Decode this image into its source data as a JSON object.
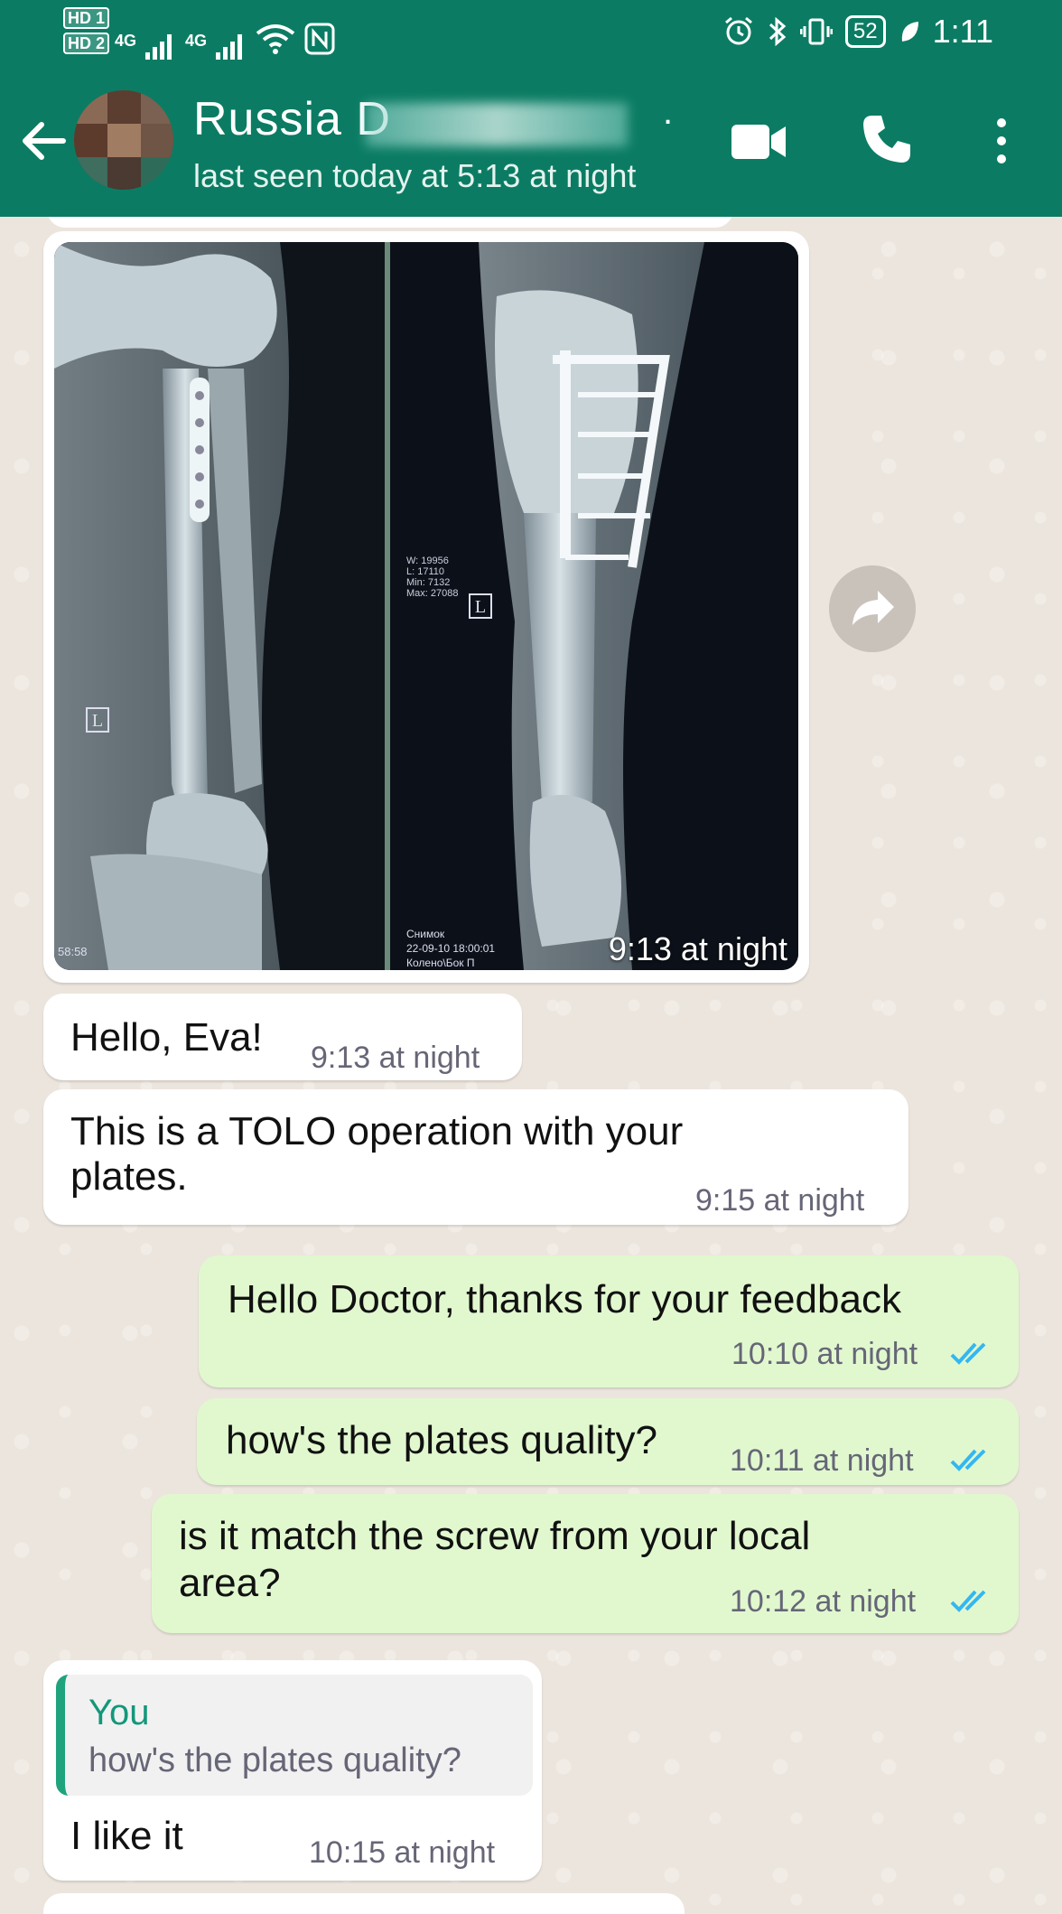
{
  "status_bar": {
    "hd1": "HD 1",
    "hd2": "HD 2",
    "signal1": "4G",
    "signal2": "4G",
    "battery": "52",
    "time": "1:11"
  },
  "header": {
    "contact_name": "Russia D",
    "contact_name_suffix": ".",
    "last_seen": "last seen today at 5:13 at night",
    "background_color": "#0b7c63"
  },
  "image_message": {
    "xray_left_label": "L",
    "xray_right_label": "L",
    "xray_info_lines": [
      "W: 19956",
      "L: 17110",
      "Min: 7132",
      "Max: 27088"
    ],
    "xray_bottom_left": "58:58",
    "xray_caption_lines": [
      "Снимок",
      "22-09-10 18:00:01",
      "Колено\\Бок П"
    ],
    "time": "9:13 at night"
  },
  "messages": [
    {
      "direction": "in",
      "text": "Hello, Eva!",
      "time": "9:13 at night"
    },
    {
      "direction": "in",
      "text_lines": [
        "This is a TOLO operation with your",
        "plates."
      ],
      "time": "9:15 at night"
    },
    {
      "direction": "out",
      "text": "Hello Doctor, thanks for your feedback",
      "time": "10:10 at night",
      "status": "read"
    },
    {
      "direction": "out",
      "text": "how's the plates quality?",
      "time": "10:11 at night",
      "status": "read"
    },
    {
      "direction": "out",
      "text_lines": [
        "is it match the screw from your local",
        "area?"
      ],
      "time": "10:12 at night",
      "status": "read"
    },
    {
      "direction": "in",
      "reply_to": {
        "author": "You",
        "text": "how's the plates quality?"
      },
      "text": "I like it",
      "time": "10:15 at night"
    }
  ],
  "colors": {
    "incoming_bubble": "#ffffff",
    "outgoing_bubble": "#e1f8cf",
    "read_ticks": "#34b7f1",
    "quote_accent": "#1ea37d"
  },
  "icons": [
    "back-arrow-icon",
    "video-call-icon",
    "phone-icon",
    "more-vert-icon",
    "forward-icon",
    "double-check-icon"
  ]
}
